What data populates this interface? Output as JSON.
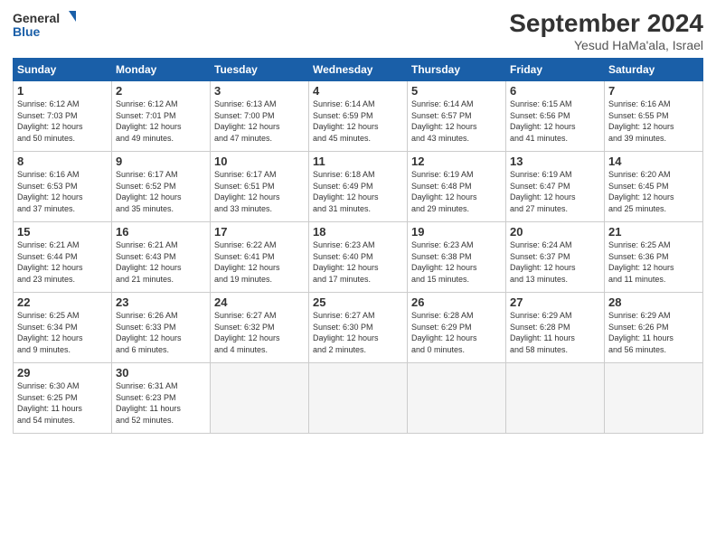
{
  "logo": {
    "line1": "General",
    "line2": "Blue"
  },
  "title": "September 2024",
  "location": "Yesud HaMa'ala, Israel",
  "weekdays": [
    "Sunday",
    "Monday",
    "Tuesday",
    "Wednesday",
    "Thursday",
    "Friday",
    "Saturday"
  ],
  "weeks": [
    [
      {
        "day": 1,
        "info": "Sunrise: 6:12 AM\nSunset: 7:03 PM\nDaylight: 12 hours\nand 50 minutes."
      },
      {
        "day": 2,
        "info": "Sunrise: 6:12 AM\nSunset: 7:01 PM\nDaylight: 12 hours\nand 49 minutes."
      },
      {
        "day": 3,
        "info": "Sunrise: 6:13 AM\nSunset: 7:00 PM\nDaylight: 12 hours\nand 47 minutes."
      },
      {
        "day": 4,
        "info": "Sunrise: 6:14 AM\nSunset: 6:59 PM\nDaylight: 12 hours\nand 45 minutes."
      },
      {
        "day": 5,
        "info": "Sunrise: 6:14 AM\nSunset: 6:57 PM\nDaylight: 12 hours\nand 43 minutes."
      },
      {
        "day": 6,
        "info": "Sunrise: 6:15 AM\nSunset: 6:56 PM\nDaylight: 12 hours\nand 41 minutes."
      },
      {
        "day": 7,
        "info": "Sunrise: 6:16 AM\nSunset: 6:55 PM\nDaylight: 12 hours\nand 39 minutes."
      }
    ],
    [
      {
        "day": 8,
        "info": "Sunrise: 6:16 AM\nSunset: 6:53 PM\nDaylight: 12 hours\nand 37 minutes."
      },
      {
        "day": 9,
        "info": "Sunrise: 6:17 AM\nSunset: 6:52 PM\nDaylight: 12 hours\nand 35 minutes."
      },
      {
        "day": 10,
        "info": "Sunrise: 6:17 AM\nSunset: 6:51 PM\nDaylight: 12 hours\nand 33 minutes."
      },
      {
        "day": 11,
        "info": "Sunrise: 6:18 AM\nSunset: 6:49 PM\nDaylight: 12 hours\nand 31 minutes."
      },
      {
        "day": 12,
        "info": "Sunrise: 6:19 AM\nSunset: 6:48 PM\nDaylight: 12 hours\nand 29 minutes."
      },
      {
        "day": 13,
        "info": "Sunrise: 6:19 AM\nSunset: 6:47 PM\nDaylight: 12 hours\nand 27 minutes."
      },
      {
        "day": 14,
        "info": "Sunrise: 6:20 AM\nSunset: 6:45 PM\nDaylight: 12 hours\nand 25 minutes."
      }
    ],
    [
      {
        "day": 15,
        "info": "Sunrise: 6:21 AM\nSunset: 6:44 PM\nDaylight: 12 hours\nand 23 minutes."
      },
      {
        "day": 16,
        "info": "Sunrise: 6:21 AM\nSunset: 6:43 PM\nDaylight: 12 hours\nand 21 minutes."
      },
      {
        "day": 17,
        "info": "Sunrise: 6:22 AM\nSunset: 6:41 PM\nDaylight: 12 hours\nand 19 minutes."
      },
      {
        "day": 18,
        "info": "Sunrise: 6:23 AM\nSunset: 6:40 PM\nDaylight: 12 hours\nand 17 minutes."
      },
      {
        "day": 19,
        "info": "Sunrise: 6:23 AM\nSunset: 6:38 PM\nDaylight: 12 hours\nand 15 minutes."
      },
      {
        "day": 20,
        "info": "Sunrise: 6:24 AM\nSunset: 6:37 PM\nDaylight: 12 hours\nand 13 minutes."
      },
      {
        "day": 21,
        "info": "Sunrise: 6:25 AM\nSunset: 6:36 PM\nDaylight: 12 hours\nand 11 minutes."
      }
    ],
    [
      {
        "day": 22,
        "info": "Sunrise: 6:25 AM\nSunset: 6:34 PM\nDaylight: 12 hours\nand 9 minutes."
      },
      {
        "day": 23,
        "info": "Sunrise: 6:26 AM\nSunset: 6:33 PM\nDaylight: 12 hours\nand 6 minutes."
      },
      {
        "day": 24,
        "info": "Sunrise: 6:27 AM\nSunset: 6:32 PM\nDaylight: 12 hours\nand 4 minutes."
      },
      {
        "day": 25,
        "info": "Sunrise: 6:27 AM\nSunset: 6:30 PM\nDaylight: 12 hours\nand 2 minutes."
      },
      {
        "day": 26,
        "info": "Sunrise: 6:28 AM\nSunset: 6:29 PM\nDaylight: 12 hours\nand 0 minutes."
      },
      {
        "day": 27,
        "info": "Sunrise: 6:29 AM\nSunset: 6:28 PM\nDaylight: 11 hours\nand 58 minutes."
      },
      {
        "day": 28,
        "info": "Sunrise: 6:29 AM\nSunset: 6:26 PM\nDaylight: 11 hours\nand 56 minutes."
      }
    ],
    [
      {
        "day": 29,
        "info": "Sunrise: 6:30 AM\nSunset: 6:25 PM\nDaylight: 11 hours\nand 54 minutes."
      },
      {
        "day": 30,
        "info": "Sunrise: 6:31 AM\nSunset: 6:23 PM\nDaylight: 11 hours\nand 52 minutes."
      },
      null,
      null,
      null,
      null,
      null
    ]
  ]
}
